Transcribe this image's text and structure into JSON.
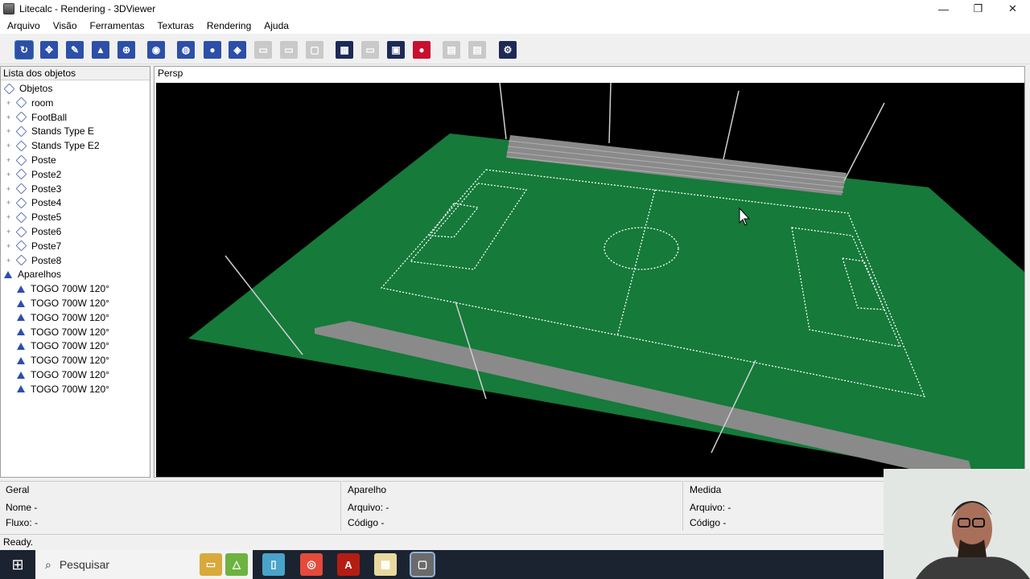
{
  "window": {
    "title": "Litecalc - Rendering - 3DViewer",
    "minimize": "—",
    "restore": "❐",
    "close": "✕"
  },
  "menu": [
    "Arquivo",
    "Visão",
    "Ferramentas",
    "Texturas",
    "Rendering",
    "Ajuda"
  ],
  "toolbar": {
    "buttons": [
      {
        "name": "rotate-icon",
        "color": "#2c4fa8",
        "glyph": "↻",
        "selected": true
      },
      {
        "name": "move-icon",
        "color": "#2c4fa8",
        "glyph": "✥"
      },
      {
        "name": "pencil-icon",
        "color": "#2c4fa8",
        "glyph": "✎"
      },
      {
        "name": "terrain-icon",
        "color": "#2c4fa8",
        "glyph": "▲"
      },
      {
        "name": "target-icon",
        "color": "#2c4fa8",
        "glyph": "⊕"
      },
      {
        "name": "camera-icon",
        "color": "#2c4fa8",
        "glyph": "◉"
      },
      {
        "name": "wireframe-sphere-icon",
        "color": "#2c4fa8",
        "glyph": "◍"
      },
      {
        "name": "solid-sphere-icon",
        "color": "#2c4fa8",
        "glyph": "●"
      },
      {
        "name": "render-icon",
        "color": "#2c4fa8",
        "glyph": "◈"
      },
      {
        "name": "view-disabled-1-icon",
        "color": "#c9c9c9",
        "glyph": "▭"
      },
      {
        "name": "view-disabled-2-icon",
        "color": "#c9c9c9",
        "glyph": "▭"
      },
      {
        "name": "view-disabled-3-icon",
        "color": "#c9c9c9",
        "glyph": "▢"
      },
      {
        "name": "checker-icon",
        "color": "#1d2a55",
        "glyph": "▦"
      },
      {
        "name": "plane-disabled-icon",
        "color": "#c9c9c9",
        "glyph": "▭"
      },
      {
        "name": "screenshot-icon",
        "color": "#1d2a55",
        "glyph": "▣"
      },
      {
        "name": "record-icon",
        "color": "#c8102e",
        "glyph": "●"
      },
      {
        "name": "export-disabled-1-icon",
        "color": "#c9c9c9",
        "glyph": "▤"
      },
      {
        "name": "export-disabled-2-icon",
        "color": "#c9c9c9",
        "glyph": "▤"
      },
      {
        "name": "settings-icon",
        "color": "#1d2a55",
        "glyph": "⚙"
      }
    ]
  },
  "sidebar": {
    "title": "Lista dos objetos",
    "root": "Objetos",
    "objects": [
      "room",
      "FootBall",
      "Stands Type E",
      "Stands Type E2",
      "Poste",
      "Poste2",
      "Poste3",
      "Poste4",
      "Poste5",
      "Poste6",
      "Poste7",
      "Poste8"
    ],
    "fixtures_group": "Aparelhos",
    "fixtures": [
      "TOGO 700W 120°",
      "TOGO 700W 120°",
      "TOGO 700W 120°",
      "TOGO 700W 120°",
      "TOGO 700W 120°",
      "TOGO 700W 120°",
      "TOGO 700W 120°",
      "TOGO 700W 120°"
    ]
  },
  "viewport": {
    "label": "Persp",
    "field_color": "#157a3a",
    "stand_color": "#8a8a8a"
  },
  "panels": {
    "geral": {
      "title": "Geral",
      "nome": "Nome -",
      "fluxo": "Fluxo: -"
    },
    "aparelho": {
      "title": "Aparelho",
      "arquivo": "Arquivo: -",
      "codigo": "Código   -"
    },
    "medida": {
      "title": "Medida",
      "arquivo": "Arquivo: -",
      "codigo": "Código   -"
    }
  },
  "status": "Ready.",
  "taskbar": {
    "search_placeholder": "Pesquisar"
  }
}
